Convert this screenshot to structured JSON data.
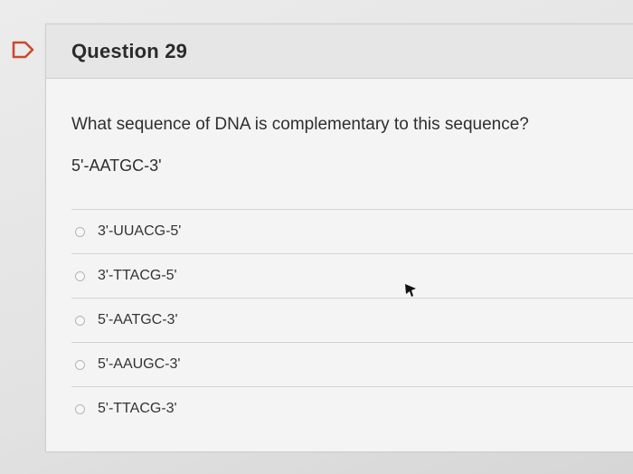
{
  "question": {
    "title": "Question 29",
    "prompt": "What sequence of DNA is complementary to this sequence?",
    "sequence": "5'-AATGC-3'",
    "answers": [
      {
        "label": "3'-UUACG-5'"
      },
      {
        "label": "3'-TTACG-5'"
      },
      {
        "label": "5'-AATGC-3'"
      },
      {
        "label": "5'-AAUGC-3'"
      },
      {
        "label": "5'-TTACG-3'"
      }
    ]
  },
  "icons": {
    "flag": "flag-icon",
    "cursor": "mouse-cursor-icon"
  },
  "colors": {
    "header_bg": "#e6e6e6",
    "card_bg": "#f4f4f4",
    "flag_stroke": "#c94a2e"
  }
}
